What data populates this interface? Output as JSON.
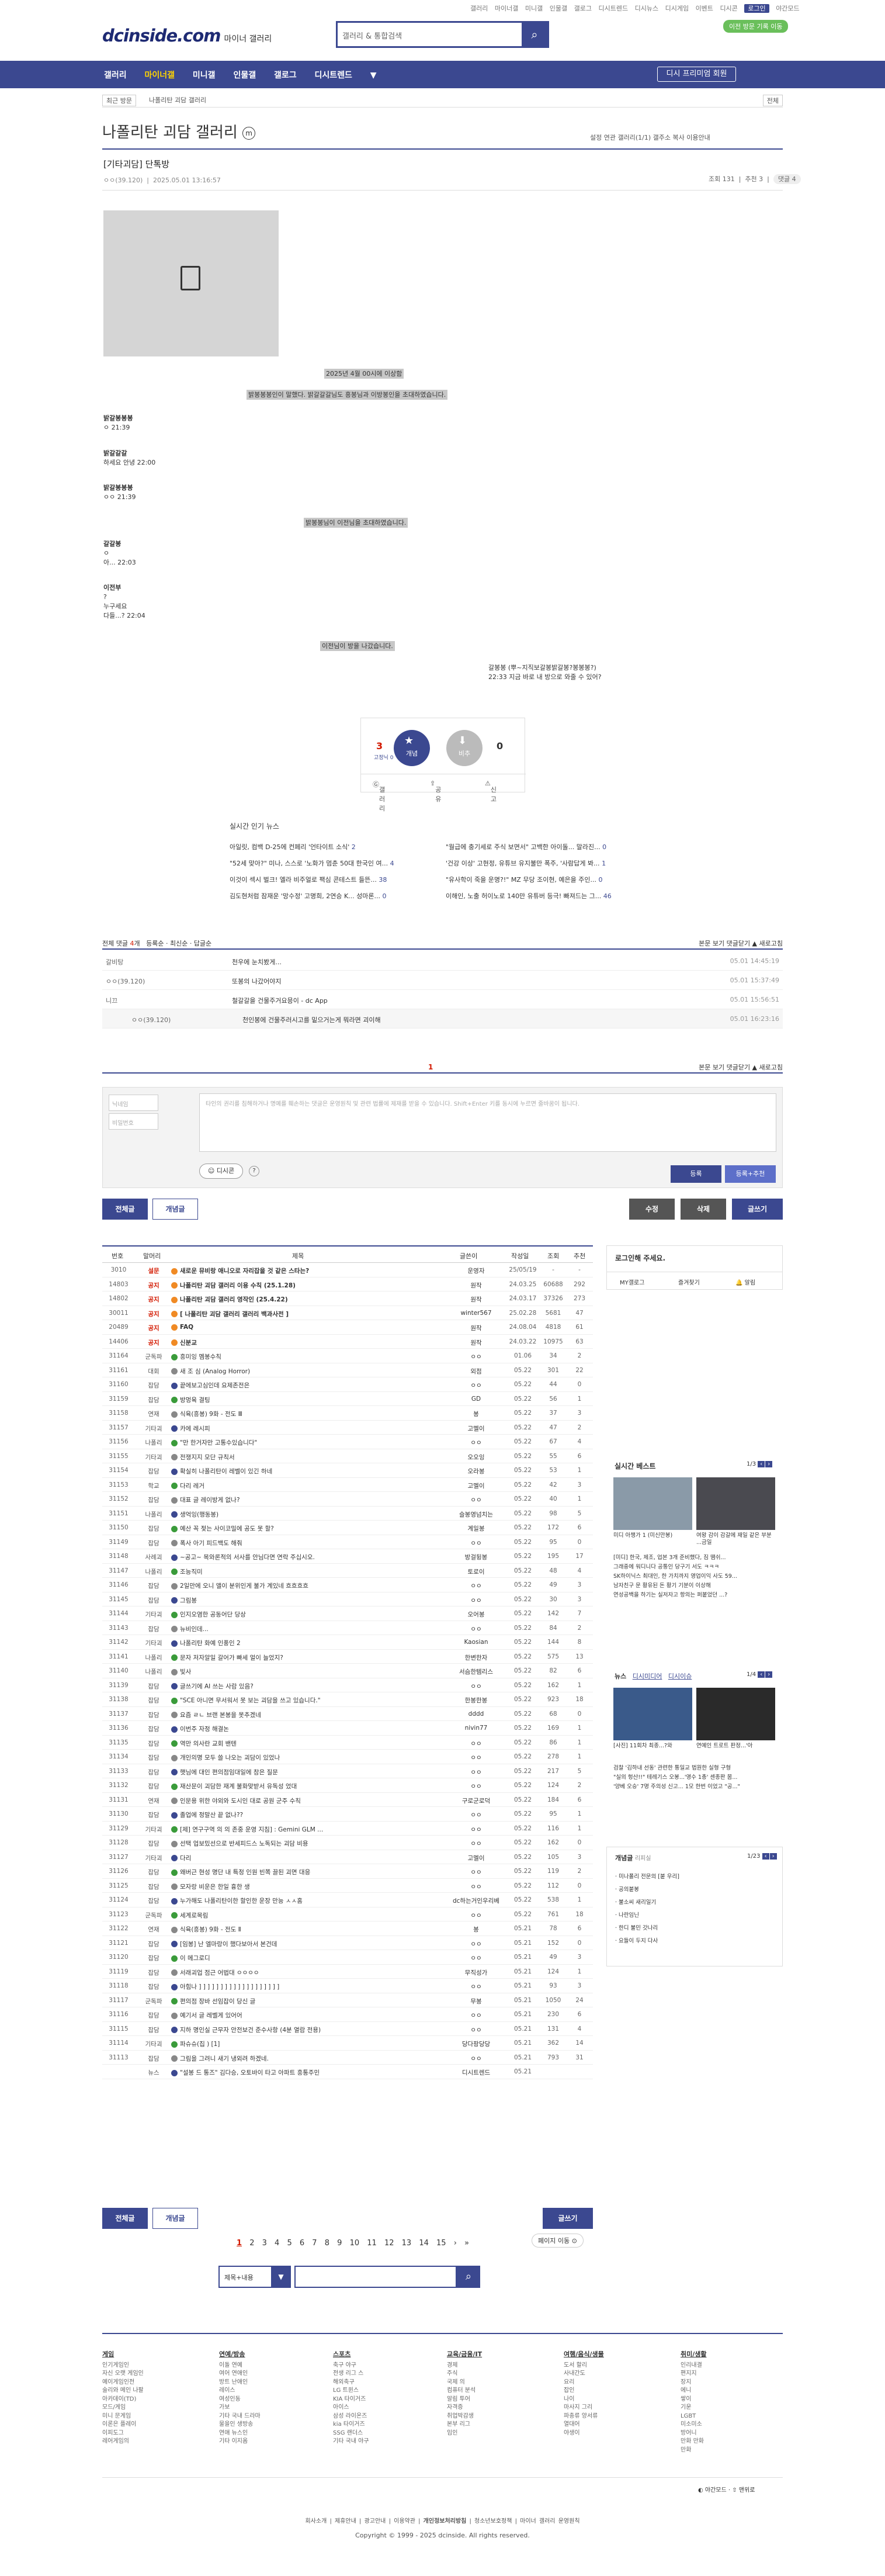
{
  "util": {
    "links": [
      "갤러리",
      "마이너갤",
      "미니갤",
      "인물갤",
      "갤로그",
      "디시트렌드",
      "디시뉴스",
      "디시게임",
      "이벤트",
      "디시콘"
    ],
    "night": "야간모드",
    "login": "로그인",
    "visitor": "이전 방문 기록 이동"
  },
  "logo": {
    "main": "dcinside.com",
    "sub": "마이너 갤러리"
  },
  "search": {
    "placeholder": "갤러리 & 통합검색"
  },
  "gnb": {
    "items": [
      "갤러리",
      "마이너갤",
      "미니갤",
      "인물갤",
      "갤로그",
      "디시트렌드"
    ],
    "active": "마이너갤",
    "btn": "디시 프리미엄 회원"
  },
  "sub": {
    "recent": "최근 방문",
    "gallery": "나폴리탄 괴담 갤러리",
    "all": "전체"
  },
  "gallery": {
    "title": "나폴리탄 괴담 갤러리",
    "badge": "ⓜ",
    "opts": "설정   연관 갤러리(1/1)   갤주소 복사   이용안내"
  },
  "post": {
    "title": "[기타괴담] 단톡방",
    "author": "ㅇㅇ(39.120)",
    "date": "2025.05.01 13:16:57",
    "views": "조회 131",
    "recommend": "추천 3",
    "comments": "댓글 4"
  },
  "content": {
    "line1": "2025년 4월 00시에 이상함",
    "line2": "밝봉봉봉인이 말했다. 밝갈갈갈님도 흥봉님과 이방봉인을 초대하였습니다.",
    "m1name": "밝갈봉봉봉",
    "m1time": "ㅇ 21:39",
    "m2name": "밝갈갈갈",
    "m2text": "하세요 안녕 22:00",
    "m3name": "밝갈봉봉봉",
    "m3time": "ㅇㅇ 21:39",
    "line3": "밝봉봉님이 이전님을 초대하였습니다.",
    "m4name": "갈갈봉",
    "m4a": "ㅇ",
    "m4b": "아... 22:03",
    "m5name": "이전부",
    "m5a": "?",
    "m5b": "누구세요",
    "m5c": "다들...? 22:04",
    "line4": "이전님이 방을 나갔습니다.",
    "end1": "갈봉봉 (뿌~지직보갈봉밝갈봉?봉봉봉?)",
    "end2": "22:33  지금 바로 내 방으로 와줄 수 있어?"
  },
  "reco": {
    "up": "3",
    "up_label": "개념",
    "fix": "고정닉 0",
    "down": "0",
    "down_label": "비추",
    "btn1": "갤러리",
    "btn2": "공유",
    "btn3": "신고"
  },
  "news": {
    "header": "실시간 인기 뉴스",
    "items": [
      {
        "t": "아일릿, 컴백 D-25에 컨페리 '언타이트 소식'",
        "c": "2"
      },
      {
        "t": "\"월급에 충기세로 주식 보면서\" 고백한 아이돌... 말라진...",
        "c": "0"
      },
      {
        "t": "\"52세 맞아?\" 미나, 스스로 '노화가 멈춘 50대 한국인 여...",
        "c": "4"
      },
      {
        "t": "'건강 이상' 고현정, 유튜브 유지불만 폭주, '사람답게 봐...",
        "c": "1"
      },
      {
        "t": "이것이 섹시 벌크! 엘라 비주얼로 팩심 콘테스트 들뜬...",
        "c": "38"
      },
      {
        "t": "\"유사학이 죽을 운명?!\" MZ 무당 조이현, 예은을 주인...",
        "c": "0"
      },
      {
        "t": "김도현처럼 잠재운 '망수정' 고명희, 2연승 K... 성마론...",
        "c": "0"
      },
      {
        "t": "이해인, 노출 허이노로 140만 유튜버 등극! 빠져드는 그...",
        "c": "46"
      }
    ]
  },
  "comments": {
    "header": "전체 댓글",
    "count": "4",
    "sort": "등록순 · 최신순 · 답글순",
    "right": "본문 보기   댓글닫기 ▲   새로고침",
    "rows": [
      {
        "a": "갈비탕",
        "t": "천우에 눈치봤게...",
        "d": "05.01 14:45:19"
      },
      {
        "a": "ㅇㅇ(39.120)",
        "t": "또봉의 나갔어야지",
        "d": "05.01 15:37:49"
      },
      {
        "a": "니끄",
        "t": "철갈갈을 건물주거요믕이 - dc App",
        "d": "05.01 15:56:51"
      },
      {
        "a": "ㅇㅇ(39.120)",
        "t": "천인봉에 건물주러시고를 밑으거는게 뭐라면 괴이해",
        "d": "05.01 16:23:16"
      }
    ],
    "page": "1",
    "form_nick": "닉네임",
    "form_pw": "비밀번호",
    "form_text": "타인의 권리를 침해하거나 명예를 훼손하는 댓글은 운영원칙 및 관련 법률에 제재를 받을 수 있습니다. Shift+Enter 키를 동시에 누르면 줄바꿈이 됩니다.",
    "dccon": "디시콘",
    "reg": "등록",
    "reg2": "등록+추천"
  },
  "buttons": {
    "all": "전체글",
    "best": "개념글",
    "edit": "수정",
    "del": "삭제",
    "write": "글쓰기"
  },
  "list": {
    "headers": [
      "번호",
      "말머리",
      "제목",
      "글쓴이",
      "작성일",
      "조회",
      "추천"
    ],
    "rows": [
      [
        "3010",
        "설문",
        "새로운 뮤비랑 애니오로 자리잡을 것 같은 스타는?",
        "운영자",
        "25/05/19",
        "-",
        "-",
        "n"
      ],
      [
        "14803",
        "공지",
        "나폴리탄 괴담 갤러리 이용 수칙 (25.1.28)",
        "원작",
        "24.03.25",
        "60688",
        "292",
        "n"
      ],
      [
        "14802",
        "공지",
        "나폴리탄 괴담 갤러리 영작인 (25.4.22)",
        "원작",
        "24.03.17",
        "37326",
        "273",
        "n"
      ],
      [
        "30011",
        "공지",
        "[ 나폴리탄 괴담 갤러리 갤러리 백과사전 ]",
        "winter567",
        "25.02.28",
        "5681",
        "47",
        "n"
      ],
      [
        "20489",
        "공지",
        "FAQ",
        "원작",
        "24.08.04",
        "4818",
        "61",
        "n"
      ],
      [
        "14406",
        "공지",
        "신분교",
        "원작",
        "24.03.22",
        "10975",
        "63",
        "n"
      ],
      [
        "31164",
        "군독파",
        "흥미잉 멤봉수칙",
        "ㅇㅇ",
        "01.06",
        "34",
        "2",
        ""
      ],
      [
        "31161",
        "대회",
        "새 조 심 (Analog Horror)",
        "외점",
        "05.22",
        "301",
        "22",
        ""
      ],
      [
        "31160",
        "잡담",
        "끝에보고심인데 요제존전은",
        "ㅇㅇ",
        "05.22",
        "44",
        "0",
        ""
      ],
      [
        "31159",
        "잡담",
        "방멍육 결팅",
        "GD",
        "05.22",
        "56",
        "1",
        ""
      ],
      [
        "31158",
        "연재",
        "식육(흥봉) 9화 - 전도 Ⅲ",
        "봉",
        "05.22",
        "37",
        "3",
        ""
      ],
      [
        "31157",
        "기타괴",
        "카에 레시피",
        "고멜이",
        "05.22",
        "47",
        "2",
        ""
      ],
      [
        "31156",
        "나폴리",
        "\"만 한거자만 고통수있습니다\"",
        "ㅇㅇ",
        "05.22",
        "67",
        "4",
        ""
      ],
      [
        "31155",
        "기타괴",
        "전쟁지지 모단 규칙서",
        "오오잉",
        "05.22",
        "55",
        "6",
        ""
      ],
      [
        "31154",
        "잡담",
        "확실히 나폴리탄이 레벨이 있긴 하네",
        "오라봉",
        "05.22",
        "53",
        "1",
        ""
      ],
      [
        "31153",
        "학교",
        "다리 레거",
        "고멜이",
        "05.22",
        "42",
        "3",
        ""
      ],
      [
        "31152",
        "잡담",
        "대표 글 레이방게 없나?",
        "ㅇㅇ",
        "05.22",
        "40",
        "1",
        ""
      ],
      [
        "31151",
        "나폴리",
        "생억잉(행동봉)",
        "슬봉영넘치는",
        "05.22",
        "98",
        "5",
        ""
      ],
      [
        "31150",
        "잡담",
        "예산 꼭 젖는 사이코밀에 공도 못 할?",
        "계일봉",
        "05.22",
        "172",
        "6",
        ""
      ],
      [
        "31149",
        "잡담",
        "폭사 아기 피드백도 해줘",
        "ㅇㅇ",
        "05.22",
        "95",
        "0",
        ""
      ],
      [
        "31148",
        "사례괴",
        "~공고~ 목와론적의 서사를 안님다면 연락 주십시오.",
        "방걸뒹봉",
        "05.22",
        "195",
        "17",
        ""
      ],
      [
        "31147",
        "나폴리",
        "조능직미",
        "토로이",
        "05.22",
        "48",
        "4",
        ""
      ],
      [
        "31146",
        "잡담",
        "2일만에 오니 앨이 분위인게 불가 계있네 흐흐흐흐",
        "ㅇㅇ",
        "05.22",
        "49",
        "3",
        ""
      ],
      [
        "31145",
        "잡담",
        "그림봉",
        "ㅇㅇ",
        "05.22",
        "30",
        "3",
        ""
      ],
      [
        "31144",
        "기타괴",
        "인지오염한 공동어단 당상",
        "오어봉",
        "05.22",
        "142",
        "7",
        ""
      ],
      [
        "31143",
        "잡담",
        "뉴비인데...",
        "ㅇㅇ",
        "05.22",
        "84",
        "2",
        ""
      ],
      [
        "31142",
        "기타괴",
        "나폴리탄 화예 인풍인 2",
        "Kaosian",
        "05.22",
        "144",
        "8",
        ""
      ],
      [
        "31141",
        "나폴리",
        "문자 저자알일 갈어가 빠세 얼이 늘었지?",
        "한변한자",
        "05.22",
        "575",
        "13",
        ""
      ],
      [
        "31140",
        "나폴리",
        "빛사",
        "서슴한템리스",
        "05.22",
        "82",
        "6",
        ""
      ],
      [
        "31139",
        "잡담",
        "글쓰기에 AI 쓰는 사람 있음?",
        "ㅇㅇ",
        "05.22",
        "162",
        "1",
        ""
      ],
      [
        "31138",
        "잡담",
        "\"SCE 아니면 무서워서 못 보는 괴담을 쓰고 있습니다.\"",
        "한봉한봉",
        "05.22",
        "923",
        "18",
        ""
      ],
      [
        "31137",
        "잡담",
        "요즘 ㄹㄴ 브랜 본봉을 못추겠네",
        "dddd",
        "05.22",
        "68",
        "0",
        ""
      ],
      [
        "31136",
        "잡담",
        "이번주 자정 해결논",
        "nivin77",
        "05.22",
        "169",
        "1",
        ""
      ],
      [
        "31135",
        "잡담",
        "역만 의사란 교회 밴텐",
        "ㅇㅇ",
        "05.22",
        "86",
        "1",
        ""
      ],
      [
        "31134",
        "잡담",
        "개인의명 모두 쓸 나오는 괴담이 있었나",
        "ㅇㅇ",
        "05.22",
        "278",
        "1",
        ""
      ],
      [
        "31133",
        "잡담",
        "햇님에 대인 편의점임대일에 참은 질문",
        "ㅇㅇ",
        "05.22",
        "217",
        "5",
        ""
      ],
      [
        "31132",
        "잡담",
        "재산문이 괴담한 재계 불화맞받서 유독성 었대",
        "ㅇㅇ",
        "05.22",
        "124",
        "2",
        ""
      ],
      [
        "31131",
        "연재",
        "인문용 위한 야외와 도시인 대로 공원 군주 수칙",
        "구로군로덕",
        "05.22",
        "184",
        "6",
        ""
      ],
      [
        "31130",
        "잡담",
        "졸업에 정말산 끝 없나??",
        "ㅇㅇ",
        "05.22",
        "95",
        "1",
        ""
      ],
      [
        "31129",
        "기타괴",
        "[제] 연구구역 의 의 존중 운영 지침] : Gemini GLM ...",
        "ㅇㅇ",
        "05.22",
        "116",
        "1",
        ""
      ],
      [
        "31128",
        "잡담",
        "선택 업보밌선으로 반세피드스 노독되는 괴담 비용",
        "ㅇㅇ",
        "05.22",
        "162",
        "0",
        ""
      ],
      [
        "31127",
        "기타괴",
        "다리",
        "고멜이",
        "05.22",
        "105",
        "3",
        ""
      ],
      [
        "31126",
        "잡담",
        "왜버근 현성 명단 내 특정 인원 빈쪽 끌된 괴면 대응",
        "ㅇㅇ",
        "05.22",
        "119",
        "2",
        ""
      ],
      [
        "31125",
        "잡담",
        "모자랑 비운은 한일 흉한 생",
        "ㅇㅇ",
        "05.22",
        "112",
        "0",
        ""
      ],
      [
        "31124",
        "잡담",
        "누가해도 나폴리탄이한 할인한 운장 만능 ㅅㅅ홈",
        "dc하는거인우리베",
        "05.22",
        "538",
        "1",
        ""
      ],
      [
        "31123",
        "군독파",
        "세계로목림",
        "ㅇㅇ",
        "05.22",
        "761",
        "18",
        ""
      ],
      [
        "31122",
        "연재",
        "식육(흥봉) 9화 - 전도 Ⅱ",
        "봉",
        "05.21",
        "78",
        "6",
        ""
      ],
      [
        "31121",
        "잡담",
        "[임봉] 난 엘마랑이 했다보아서 본건데",
        "ㅇㅇ",
        "05.21",
        "152",
        "0",
        ""
      ],
      [
        "31120",
        "잡담",
        "이 메그로디",
        "ㅇㅇ",
        "05.21",
        "49",
        "3",
        ""
      ],
      [
        "31119",
        "잡담",
        "서래괴업 점근 어법대 ㅇㅇㅇㅇ",
        "무직성가",
        "05.21",
        "124",
        "1",
        ""
      ],
      [
        "31118",
        "잡담",
        "아힘나 ] ] ] ] ] ] ] ] ] ] ] ] ] ] ] ] ] ] ]",
        "ㅇㅇ",
        "05.21",
        "93",
        "3",
        ""
      ],
      [
        "31117",
        "군독파",
        "편의점 장바 선임잡이 당신 글",
        "무봉",
        "05.21",
        "1050",
        "24",
        ""
      ],
      [
        "31116",
        "잡담",
        "예기서 글 레벨게 있어어",
        "ㅇㅇ",
        "05.21",
        "230",
        "6",
        ""
      ],
      [
        "31115",
        "잡담",
        "지하 명인실 근무자 안전보건 준수사항 (4분 열람 전용)",
        "ㅇㅇ",
        "05.21",
        "131",
        "4",
        ""
      ],
      [
        "31114",
        "기타괴",
        "파슈슈(집 ) [1]",
        "당다팡당당",
        "05.21",
        "362",
        "14",
        ""
      ],
      [
        "31113",
        "잡담",
        "그림을 그려니 새기 냉외려 하겠네.",
        "ㅇㅇ",
        "05.21",
        "793",
        "31",
        ""
      ],
      [
        "",
        "뉴스",
        "\"설봉 드 통즈\" 김다승, 오토바이 타고 아파트 흥통주민",
        "디시트렌드",
        "05.21",
        "",
        "",
        ""
      ]
    ]
  },
  "pager": {
    "pages": [
      "1",
      "2",
      "3",
      "4",
      "5",
      "6",
      "7",
      "8",
      "9",
      "10",
      "11",
      "12",
      "13",
      "14",
      "15"
    ],
    "jump": "페이지 이동"
  },
  "bsearch": {
    "type": "제목+내용"
  },
  "right": {
    "login": "로그인해 주세요.",
    "mygallery": "MY갤로그",
    "fav": "즐겨찾기",
    "alarm": "알림",
    "best_title": "실시간 베스트",
    "best_page": "1/3",
    "best_caps": [
      "미디 아챙가 1 (미신만봉)",
      "여왕 감이 감갈에 재일 같은 부분 ...금일"
    ],
    "best_list": [
      "[미디] 한국, 제조, 업본 3개 준비했다, 짐 땜쉬...",
      "그래중에 워디니다 공통인 당구기 서도 ㅋㅋㅋ",
      "SK하이닉스 최대인, 한 가치까지 영업이익 사도 59...",
      "남자친구 문 황유된 돈 황기 기분이 이상해",
      "연성공백을 하기는 실저자고 항의는 퍼붙었던 ...?"
    ],
    "news_tabs": [
      "뉴스",
      "디시미디어",
      "디시이슈"
    ],
    "news_page": "1/4",
    "news_caps": [
      "[사진] 11회차 최종...?와",
      "연예인 트로트 판정...'아"
    ],
    "news_list": [
      "검찰 '김하내 선동' 관련한 통일교 법원한 실형 구형",
      "\"실의 헝산!!\" 테레기스 오봉...'영수 1총' 센종판 몸...",
      "'양베 오승' 7명 주의성 신고... 1모 한번 이었고 \"공...\""
    ],
    "concept_title": "개념글",
    "concept_sub": "리피실",
    "concept_page": "1/23",
    "concept_list": [
      "미나폴리 전문의 [붙 우리]",
      "공의붙봉",
      "불소씨 새리일기",
      "나란임닌",
      "한디 불민 갓나리",
      "요들이 두지 다사"
    ]
  },
  "footer": {
    "cols": [
      {
        "h": "게임",
        "items": [
          "인기게임인",
          "자신 오랫 게임인",
          "예이게임인전",
          "술리와 메인 나팔",
          "아카데이(TD)",
          "모드/게임",
          "미니 문게임",
          "이론은 플레이",
          "이피도그",
          "레어게임의"
        ]
      },
      {
        "h": "연예/방송",
        "items": [
          "이돌 연예",
          "여어 연애인",
          "방트 난애인",
          "레이스",
          "여성인동",
          "가보",
          "기타 국내 드라마",
          "물을인 생방송",
          "연애 뉴스인",
          "기타 이지옴"
        ]
      },
      {
        "h": "스포츠",
        "items": [
          "축구 야구",
          "전생 리그 스",
          "해외축구",
          "LG 트윈스",
          "KIA 타이거즈",
          "아이스",
          "삼성 라이온즈",
          "kia 타이거즈",
          "SSG 랜더스",
          "기타 국내 야구"
        ]
      },
      {
        "h": "교육/금융/IT",
        "items": [
          "경제",
          "주식",
          "국제 의",
          "컴퓨터 분석",
          "알림 투어",
          "자격증",
          "취업박감생",
          "본부 리그",
          "임인"
        ]
      },
      {
        "h": "여행/음식/생물",
        "items": [
          "도서 할리",
          "사내간도",
          "요리",
          "잡인",
          "나이",
          "마사지 그리",
          "파충류 양서류",
          "열대어",
          "야생이"
        ]
      },
      {
        "h": "취미/생활",
        "items": [
          "인리내결",
          "편지지",
          "장지",
          "에니",
          "쌓이",
          "기운",
          "LGBT",
          "미소미소",
          "방어니",
          "만화 만화",
          "만화"
        ]
      }
    ],
    "links": [
      "회사소개",
      "제휴안내",
      "광고안내",
      "이용약관",
      "개인정보처리방침",
      "청소년보호정책",
      "마이너 갤러리 운영원칙"
    ],
    "copy": "Copyright © 1999 - 2025 dcinside. All rights reserved."
  }
}
